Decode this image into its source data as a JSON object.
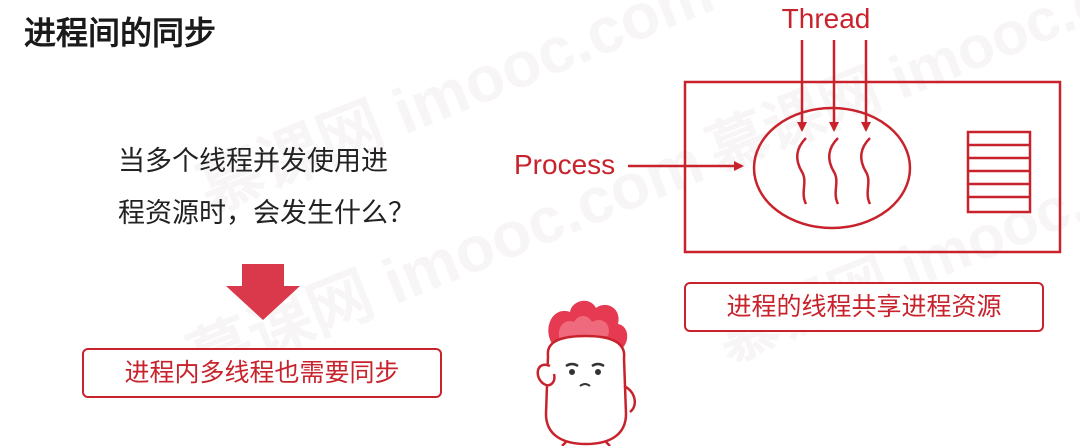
{
  "slide": {
    "title": "进程间的同步",
    "watermark": "慕课网 imooc.com",
    "question_line1": "当多个线程并发使用进",
    "question_line2": "程资源时，会发生什么？",
    "conclusion": "进程内多线程也需要同步"
  },
  "diagram": {
    "thread_label": "Thread",
    "process_label": "Process",
    "shared_caption": "进程的线程共享进程资源"
  },
  "colors": {
    "accent": "#c8232c",
    "arrow_fill": "#d9394a",
    "text": "#222222"
  }
}
